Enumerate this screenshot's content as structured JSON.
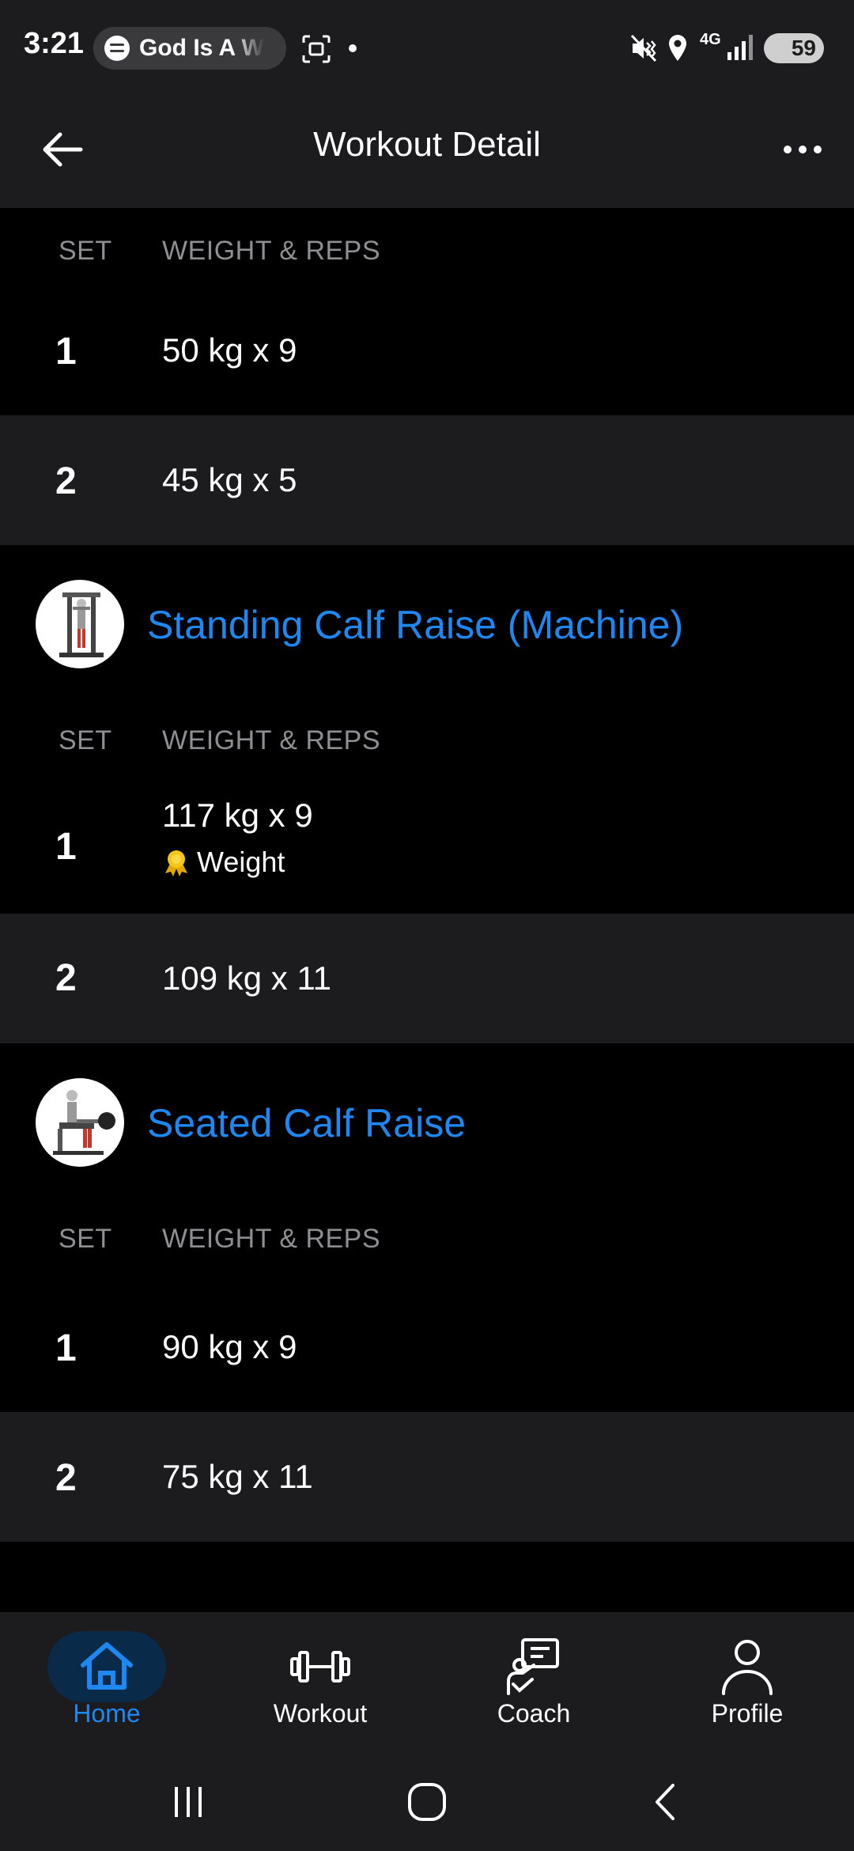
{
  "status_bar": {
    "time": "3:21",
    "media_text": "God Is A W",
    "network": "4G",
    "battery": "59"
  },
  "header": {
    "title": "Workout Detail"
  },
  "table_headers": {
    "set": "SET",
    "weight_reps": "WEIGHT & REPS"
  },
  "first_exercise": {
    "sets": [
      {
        "set": "1",
        "value": "50 kg x 9"
      },
      {
        "set": "2",
        "value": "45 kg x 5"
      }
    ]
  },
  "exercise_2": {
    "name": "Standing Calf Raise (Machine)",
    "sets": [
      {
        "set": "1",
        "value": "117 kg x 9",
        "badge": "Weight"
      },
      {
        "set": "2",
        "value": "109 kg x 11"
      }
    ]
  },
  "exercise_3": {
    "name": "Seated Calf Raise",
    "sets": [
      {
        "set": "1",
        "value": "90 kg x 9"
      },
      {
        "set": "2",
        "value": "75 kg x 11"
      }
    ]
  },
  "nav": {
    "home": "Home",
    "workout": "Workout",
    "coach": "Coach",
    "profile": "Profile",
    "active": "home"
  },
  "colors": {
    "accent": "#1e88f0",
    "row_alt": "#1c1c1e",
    "background": "#000000",
    "medal": "#f5c518"
  }
}
